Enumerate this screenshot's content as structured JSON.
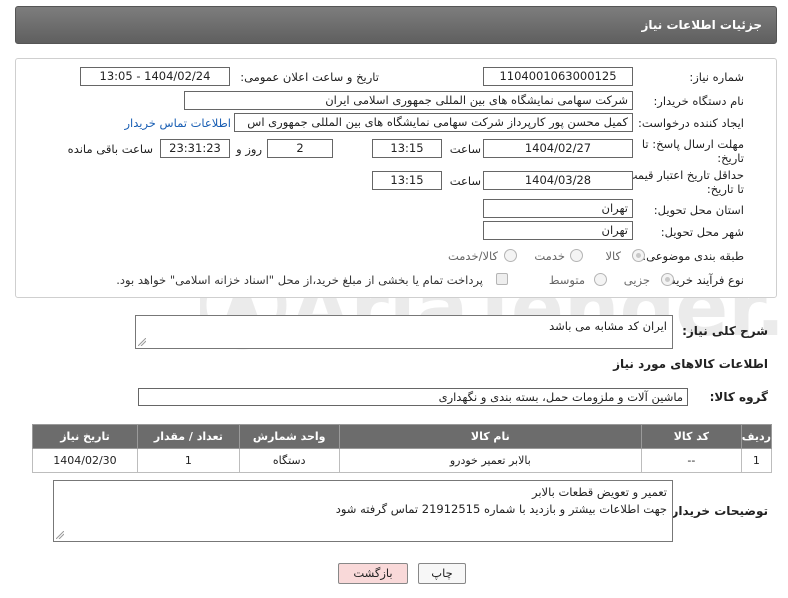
{
  "header": {
    "title": "جزئیات اطلاعات نیاز"
  },
  "form": {
    "need_number": {
      "label": "شماره نیاز:",
      "value": "1104001063000125"
    },
    "announce": {
      "label": "تاریخ و ساعت اعلان عمومی:",
      "value": "1404/02/24 - 13:05"
    },
    "buyer_org": {
      "label": "نام دستگاه خریدار:",
      "value": "شرکت سهامی نمایشگاه های بین المللی جمهوری اسلامی ایران"
    },
    "requester": {
      "label": "ایجاد کننده درخواست:",
      "value": "کمیل محسن پور کارپرداز شرکت سهامی نمایشگاه های بین المللی جمهوری اس",
      "link": "اطلاعات تماس خریدار"
    },
    "reply_deadline": {
      "label_line1": "مهلت ارسال پاسخ: تا",
      "label_line2": "تاریخ:",
      "date": "1404/02/27",
      "time_label": "ساعت",
      "time": "13:15",
      "days": "2",
      "days_label": "روز و",
      "remaining": "23:31:23",
      "remaining_label": "ساعت باقی مانده"
    },
    "price_validity": {
      "label_line1": "حداقل تاریخ اعتبار قیمت:",
      "label_line2": "تا تاریخ:",
      "date": "1404/03/28",
      "time_label": "ساعت",
      "time": "13:15"
    },
    "province": {
      "label": "استان محل تحویل:",
      "value": "تهران"
    },
    "city": {
      "label": "شهر محل تحویل:",
      "value": "تهران"
    },
    "category": {
      "label": "طبقه بندی موضوعی:",
      "options": [
        "کالا",
        "خدمت",
        "کالا/خدمت"
      ],
      "selected": "کالا"
    },
    "process": {
      "label": "نوع فرآیند خرید :",
      "options": [
        "جزیی",
        "متوسط"
      ],
      "selected": "جزیی",
      "note": "پرداخت تمام یا بخشی از مبلغ خرید،از محل \"اسناد خزانه اسلامی\" خواهد بود."
    }
  },
  "description": {
    "label": "شرح کلی نیاز:",
    "value": "ایران کد مشابه می باشد"
  },
  "goods_section": {
    "title": "اطلاعات کالاهای مورد نیاز"
  },
  "goods_group": {
    "label": "گروه کالا:",
    "value": "ماشین آلات و ملزومات حمل، بسته بندی و نگهداری"
  },
  "table": {
    "headers": [
      "ردیف",
      "کد کالا",
      "نام کالا",
      "واحد شمارش",
      "تعداد / مقدار",
      "تاریخ نیاز"
    ],
    "rows": [
      [
        "1",
        "--",
        "بالابر تعمیر خودرو",
        "دستگاه",
        "1",
        "1404/02/30"
      ]
    ]
  },
  "buyer_notes": {
    "label": "توضیحات خریدار:",
    "line1": "تعمیر و تعویض قطعات بالابر",
    "line2": "جهت اطلاعات بیشتر و بازدید با شماره 21912515 تماس گرفته شود"
  },
  "buttons": {
    "print": "چاپ",
    "back": "بازگشت"
  },
  "watermark": {
    "text": "AriaTender.neT"
  },
  "colors": {
    "header_bg": "#6e6e6e",
    "table_header_bg": "#6c6c6c",
    "link": "#1a5fb4",
    "back_button_bg": "#f9d9d9"
  }
}
